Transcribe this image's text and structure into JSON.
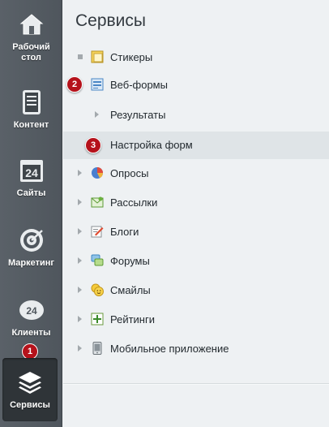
{
  "sidebar": {
    "items": [
      {
        "label": "Рабочий стол",
        "icon": "home-icon"
      },
      {
        "label": "Контент",
        "icon": "document-icon"
      },
      {
        "label": "Сайты",
        "icon": "calendar-24-icon"
      },
      {
        "label": "Маркетинг",
        "icon": "target-icon"
      },
      {
        "label": "Клиенты",
        "icon": "cloud-24-icon"
      },
      {
        "label": "Сервисы",
        "icon": "layers-icon"
      }
    ],
    "active": "Сервисы",
    "badge": "1"
  },
  "main": {
    "title": "Сервисы",
    "menu": [
      {
        "label": "Стикеры",
        "icon": "sticker-icon"
      },
      {
        "label": "Веб-формы",
        "icon": "webform-icon",
        "badge": "2"
      },
      {
        "label": "Результаты"
      },
      {
        "label": "Настройка форм",
        "badge": "3"
      },
      {
        "label": "Опросы",
        "icon": "pie-chart-icon"
      },
      {
        "label": "Рассылки",
        "icon": "mail-icon"
      },
      {
        "label": "Блоги",
        "icon": "blog-icon"
      },
      {
        "label": "Форумы",
        "icon": "forum-icon"
      },
      {
        "label": "Смайлы",
        "icon": "smiley-icon"
      },
      {
        "label": "Рейтинги",
        "icon": "rating-icon"
      },
      {
        "label": "Мобильное приложение",
        "icon": "mobile-icon"
      }
    ]
  },
  "colors": {
    "sidebar_bg": "#555c63",
    "active_bg": "#2f3438",
    "badge": "#b5121b",
    "selected_row": "#dfe4e7"
  }
}
